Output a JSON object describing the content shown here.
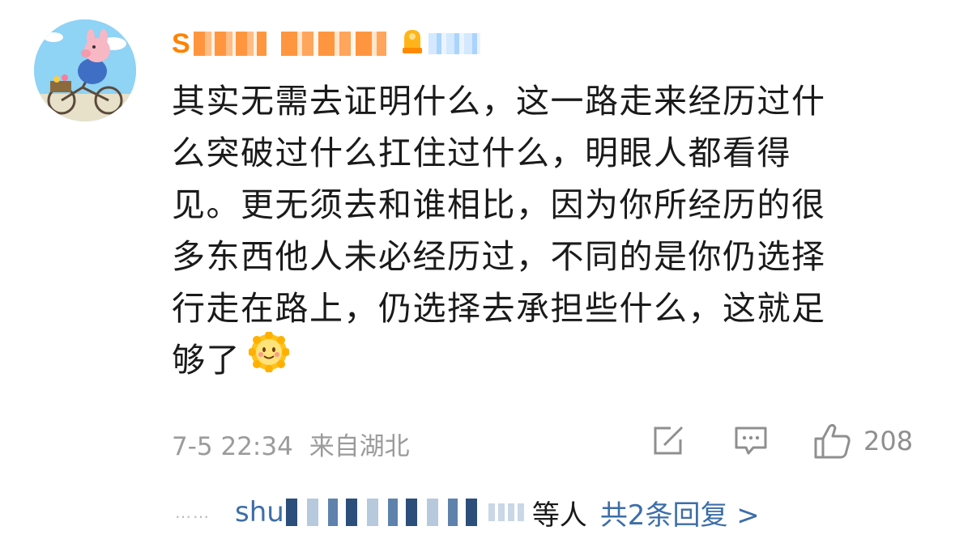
{
  "user": {
    "name_visible": "S",
    "avatar_icon": "cartoon-pig-on-bicycle-avatar",
    "badge_icon": "orange-member-badge-icon"
  },
  "comment": {
    "lines": [
      "其实无需去证明什么，这一路走来经历过什",
      "么突破过什么扛住过什么，明眼人都看得",
      "见。更无须去和谁相比，因为你所经历的很",
      "多东西他人未必经历过，不同的是你仍选择",
      "行走在路上，仍选择去承担些什么，这就足",
      "够了"
    ],
    "emoji": "smiling-sun-emoji"
  },
  "meta": {
    "timestamp": "7-5 22:34",
    "location": "来自湖北"
  },
  "actions": {
    "share_icon": "share-edit-icon",
    "comment_icon": "comment-bubble-icon",
    "like_icon": "thumbs-up-icon",
    "like_count": "208"
  },
  "replies": {
    "dots": "……",
    "name_visible": "shu",
    "suffix_visible": "等人",
    "summary": "共2条回复 >"
  },
  "colors": {
    "username": "#ff8200",
    "text": "#1a1a1a",
    "meta": "#9b9b9b",
    "link": "#3d6ea8"
  }
}
